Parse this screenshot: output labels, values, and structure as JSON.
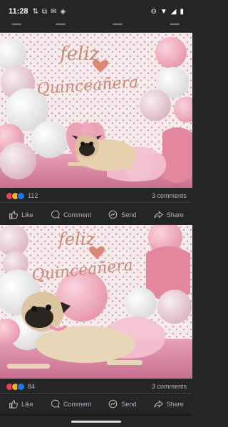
{
  "status_bar": {
    "time": "11:28",
    "notification_icons": [
      "signal-icon",
      "slack-icon",
      "gmail-icon",
      "nfl-icon"
    ],
    "system_icons": [
      "dnd-icon",
      "wifi-icon",
      "signal-bars-icon",
      "battery-icon"
    ]
  },
  "posts": [
    {
      "photo": {
        "banner_line1": "feliz",
        "banner_line2": "Quinceañera"
      },
      "reactions": {
        "count": "112",
        "icons": [
          "love-icon",
          "haha-icon",
          "like-icon"
        ]
      },
      "comments": "3 comments",
      "actions": [
        "Like",
        "Comment",
        "Send",
        "Share"
      ]
    },
    {
      "photo": {
        "banner_line1": "feliz",
        "banner_line2": "Quinceañera"
      },
      "reactions": {
        "count": "84",
        "icons": [
          "love-icon",
          "haha-icon",
          "like-icon"
        ]
      },
      "comments": "3 comments",
      "actions": [
        "Like",
        "Comment",
        "Send",
        "Share"
      ]
    }
  ],
  "colors": {
    "bg": "#242526",
    "text": "#b0b3b8",
    "love": "#f33e58",
    "haha": "#f7b125",
    "like": "#1877f2"
  }
}
